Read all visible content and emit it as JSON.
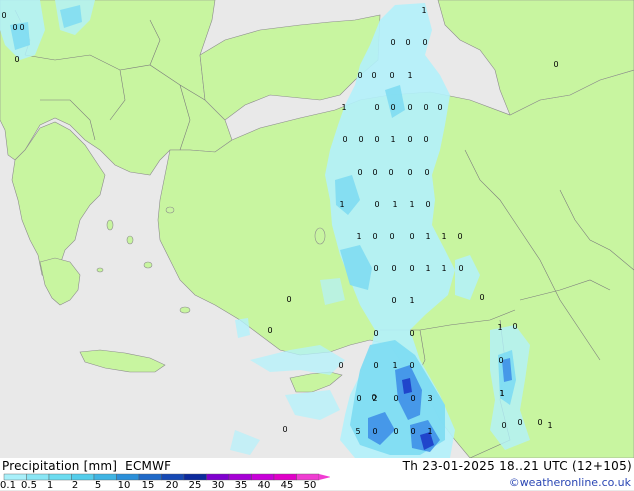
{
  "header": {
    "title": "Precipitation [mm]",
    "model": "ECMWF",
    "valid_time": "Th 23-01-2025 18..21 UTC (12+105)",
    "credit": "©weatheronline.co.uk"
  },
  "legend": {
    "labels": [
      "0.1",
      "0.5",
      "1",
      "2",
      "5",
      "10",
      "15",
      "20",
      "25",
      "30",
      "35",
      "40",
      "45",
      "50"
    ],
    "colors": [
      "#a9f0fa",
      "#8ae6f5",
      "#6cdcf0",
      "#54cdeb",
      "#3fb4e3",
      "#2b8fd9",
      "#1f69c8",
      "#1649b4",
      "#0c2a9c",
      "#7f00cf",
      "#a600d6",
      "#c800d9",
      "#e000c8",
      "#f03cd2"
    ]
  },
  "colors": {
    "sea": "#e9e9e9",
    "land": "#c8f5a0",
    "border": "#8c8c8c",
    "precip_light": "#b3f1fb",
    "precip_mid": "#7fdcf2",
    "precip_heavy": "#3c8ce6",
    "precip_peak": "#1c3cc8"
  },
  "station_values": [
    {
      "label": "1"
    },
    {
      "label": "0"
    },
    {
      "label": "0"
    },
    {
      "label": "0"
    },
    {
      "label": "0"
    },
    {
      "label": "0"
    },
    {
      "label": "0"
    },
    {
      "label": "1"
    },
    {
      "label": "0"
    },
    {
      "label": "0"
    },
    {
      "label": "1"
    },
    {
      "label": "0"
    },
    {
      "label": "0"
    },
    {
      "label": "0"
    },
    {
      "label": "0"
    },
    {
      "label": "0"
    },
    {
      "label": "0"
    },
    {
      "label": "0"
    },
    {
      "label": "1"
    },
    {
      "label": "0"
    },
    {
      "label": "0"
    },
    {
      "label": "0"
    },
    {
      "label": "0"
    },
    {
      "label": "0"
    },
    {
      "label": "0"
    },
    {
      "label": "0"
    },
    {
      "label": "1"
    },
    {
      "label": "0"
    },
    {
      "label": "1"
    },
    {
      "label": "1"
    },
    {
      "label": "0"
    },
    {
      "label": "1"
    },
    {
      "label": "0"
    },
    {
      "label": "0"
    },
    {
      "label": "0"
    },
    {
      "label": "1"
    },
    {
      "label": "1"
    },
    {
      "label": "0"
    },
    {
      "label": "0"
    },
    {
      "label": "0"
    },
    {
      "label": "0"
    },
    {
      "label": "1"
    },
    {
      "label": "1"
    },
    {
      "label": "0"
    },
    {
      "label": "0"
    },
    {
      "label": "0"
    },
    {
      "label": "1"
    },
    {
      "label": "0"
    },
    {
      "label": "0"
    },
    {
      "label": "0"
    },
    {
      "label": "0"
    },
    {
      "label": "1"
    },
    {
      "label": "0"
    },
    {
      "label": "0"
    },
    {
      "label": "0"
    },
    {
      "label": "1"
    },
    {
      "label": "0"
    },
    {
      "label": "0"
    },
    {
      "label": "0"
    },
    {
      "label": "2"
    },
    {
      "label": "0"
    },
    {
      "label": "0"
    },
    {
      "label": "3"
    },
    {
      "label": "1"
    },
    {
      "label": "5"
    },
    {
      "label": "0"
    },
    {
      "label": "0"
    },
    {
      "label": "0"
    },
    {
      "label": "1"
    },
    {
      "label": "0"
    },
    {
      "label": "0"
    },
    {
      "label": "0"
    },
    {
      "label": "1"
    },
    {
      "label": "0"
    },
    {
      "label": "0"
    },
    {
      "label": "0"
    },
    {
      "label": "0"
    },
    {
      "label": "0"
    },
    {
      "label": "0"
    },
    {
      "label": "1"
    }
  ]
}
